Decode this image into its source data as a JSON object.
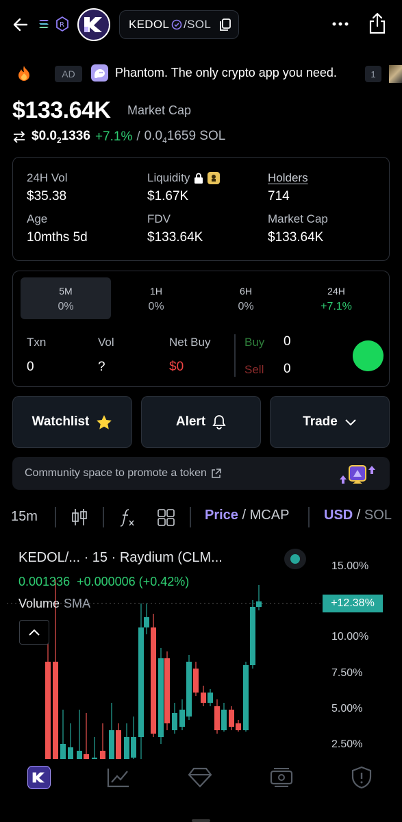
{
  "header": {
    "pair_symbol": "KEDOL",
    "pair_quote": "/SOL"
  },
  "ad": {
    "badge": "AD",
    "text": "Phantom. The only crypto app you need.",
    "count": "1"
  },
  "summary": {
    "market_cap_value": "$133.64K",
    "market_cap_label": "Market Cap",
    "price_usd_prefix": "$0.0",
    "price_usd_sub": "2",
    "price_usd_suffix": "1336",
    "change": "+7.1%",
    "separator": "/",
    "price_sol_prefix": "0.0",
    "price_sol_sub": "4",
    "price_sol_suffix": "1659 SOL"
  },
  "stats": {
    "vol24_label": "24H Vol",
    "vol24_value": "$35.38",
    "liquidity_label": "Liquidity",
    "liquidity_value": "$1.67K",
    "holders_label": "Holders",
    "holders_value": "714",
    "age_label": "Age",
    "age_value": "10mths 5d",
    "fdv_label": "FDV",
    "fdv_value": "$133.64K",
    "mcap_label": "Market Cap",
    "mcap_value": "$133.64K"
  },
  "timeframes": [
    {
      "name": "5M",
      "value": "0%"
    },
    {
      "name": "1H",
      "value": "0%"
    },
    {
      "name": "6H",
      "value": "0%"
    },
    {
      "name": "24H",
      "value": "+7.1%"
    }
  ],
  "activity": {
    "txn_label": "Txn",
    "txn_value": "0",
    "vol_label": "Vol",
    "vol_value": "?",
    "netbuy_label": "Net Buy",
    "netbuy_value": "$0",
    "buy_label": "Buy",
    "buy_value": "0",
    "sell_label": "Sell",
    "sell_value": "0"
  },
  "actions": {
    "watchlist": "Watchlist",
    "alert": "Alert",
    "trade": "Trade"
  },
  "community": {
    "text": "Community space to promote a token"
  },
  "chart_toolbar": {
    "interval": "15m",
    "price": "Price",
    "slash1": "/",
    "mcap": "MCAP",
    "usd": "USD",
    "slash2": "/",
    "sol": "SOL"
  },
  "chart": {
    "title": "KEDOL/...  · 15 · Raydium (CLM...",
    "ohlc_price": "0.001336",
    "ohlc_change": "+0.000006 (+0.42%)",
    "volume_label": "Volume",
    "sma_label": "SMA",
    "last_label": "+12.38%",
    "axis_ticks": [
      "15.00%",
      "10.00%",
      "7.50%",
      "5.00%",
      "2.50%"
    ]
  },
  "colors": {
    "up": "#26a69a",
    "down": "#ef5350",
    "positive_text": "#2ecc71",
    "accent_purple": "#8c7bff",
    "green_dot": "#19d65a"
  }
}
